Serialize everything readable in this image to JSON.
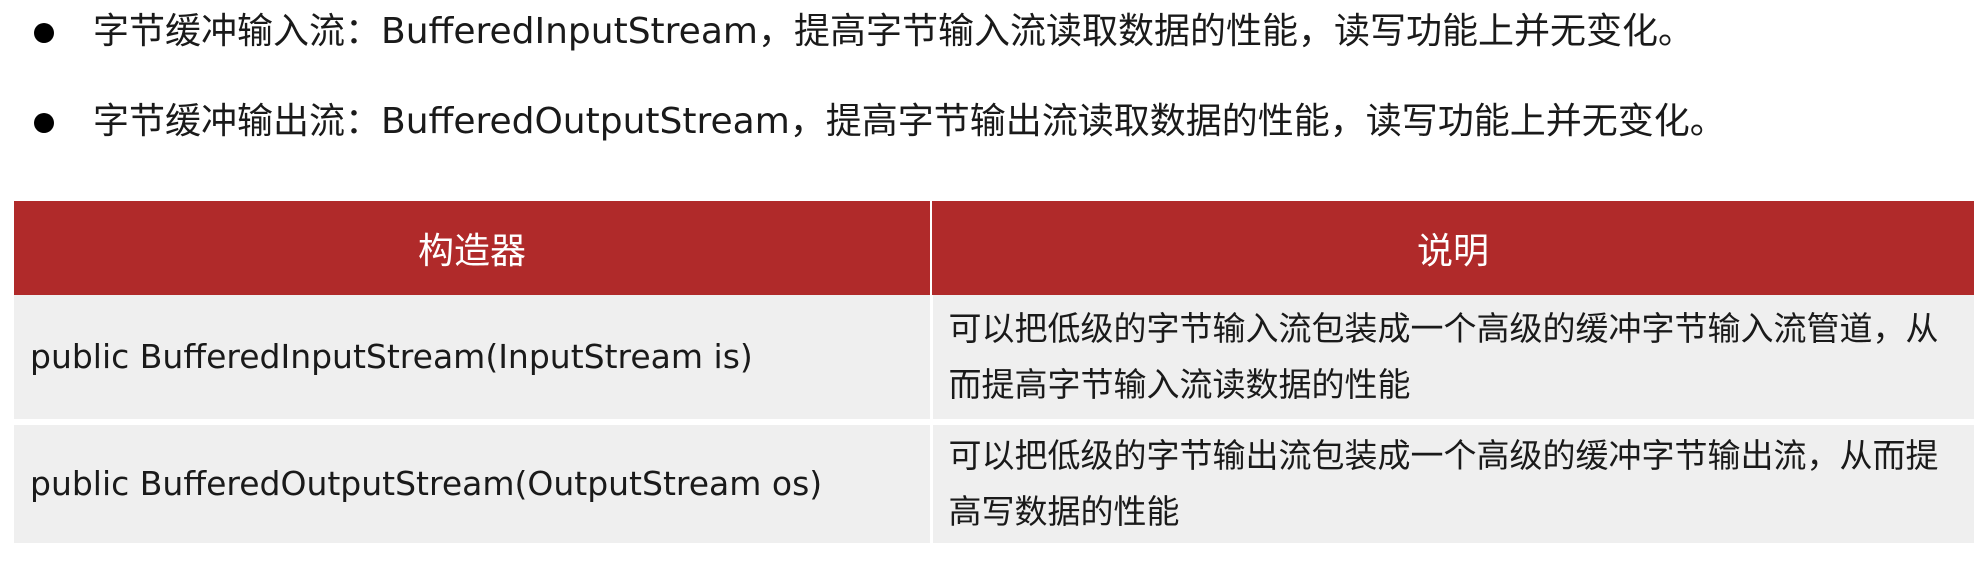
{
  "bullets": [
    {
      "text": "字节缓冲输入流：BufferedInputStream，提高字节输入流读取数据的性能，读写功能上并无变化。"
    },
    {
      "text": "字节缓冲输出流：BufferedOutputStream，提高字节输出流读取数据的性能，读写功能上并无变化。"
    }
  ],
  "table": {
    "headers": [
      "构造器",
      "说明"
    ],
    "rows": [
      {
        "signature": "public BufferedInputStream(InputStream is)",
        "description": "可以把低级的字节输入流包装成一个高级的缓冲字节输入流管道，从而提高字节输入流读数据的性能"
      },
      {
        "signature": "public BufferedOutputStream(OutputStream os)",
        "description": "可以把低级的字节输出流包装成一个高级的缓冲字节输出流，从而提高写数据的性能"
      }
    ]
  },
  "colors": {
    "header_bg": "#b02a2a",
    "header_text": "#ffffff",
    "cell_bg": "#efefef",
    "bullet": "#000000"
  }
}
